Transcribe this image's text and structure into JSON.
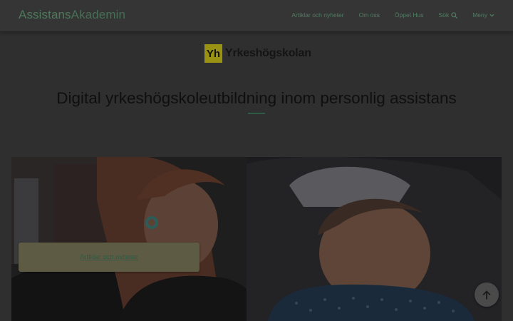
{
  "header": {
    "logo_part1": "Assistans",
    "logo_part2": "Akademin",
    "nav": [
      {
        "label": "Artiklar och nyheter"
      },
      {
        "label": "Om oss"
      },
      {
        "label": "Öppet Hus"
      },
      {
        "label": "Sök",
        "icon": "search-icon"
      },
      {
        "label": "Meny",
        "icon": "chevron-down-icon"
      }
    ]
  },
  "yh": {
    "badge": "Yh",
    "name": "Yrkeshögskolan"
  },
  "page": {
    "title": "Digital yrkeshögskoleutbildning inom personlig assistans"
  },
  "card": {
    "link_label": "Artiklar och nyheter"
  },
  "colors": {
    "accent": "#4c7a5a",
    "overlay": "#2f2f2f",
    "yh_yellow": "#9a9212"
  }
}
